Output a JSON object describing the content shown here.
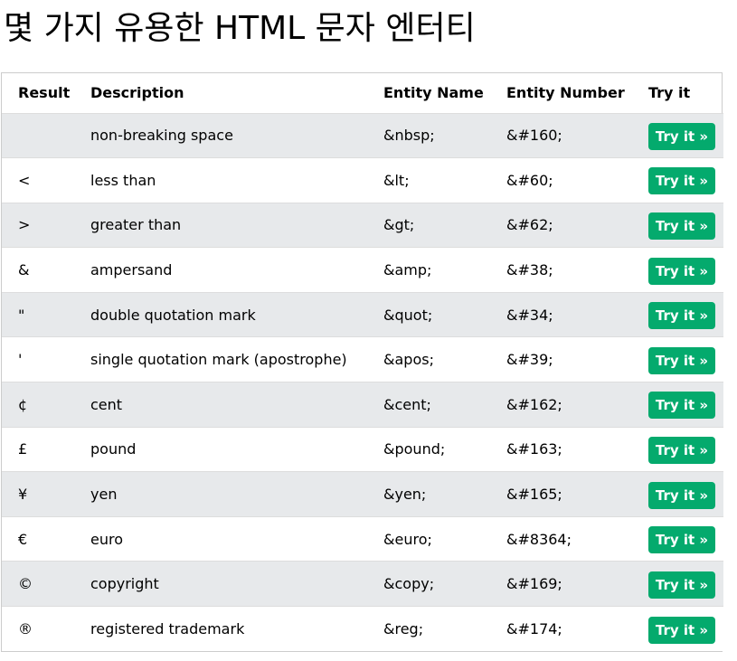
{
  "title": "몇 가지 유용한 HTML 문자 엔터티",
  "table": {
    "headers": {
      "result": "Result",
      "description": "Description",
      "entity_name": "Entity Name",
      "entity_number": "Entity Number",
      "try_it": "Try it"
    },
    "button_label": "Try it »",
    "rows": [
      {
        "result": " ",
        "description": "non-breaking space",
        "entity_name": "&nbsp;",
        "entity_number": "&#160;"
      },
      {
        "result": "<",
        "description": "less than",
        "entity_name": "&lt;",
        "entity_number": "&#60;"
      },
      {
        "result": ">",
        "description": "greater than",
        "entity_name": "&gt;",
        "entity_number": "&#62;"
      },
      {
        "result": "&",
        "description": "ampersand",
        "entity_name": "&amp;",
        "entity_number": "&#38;"
      },
      {
        "result": "\"",
        "description": "double quotation mark",
        "entity_name": "&quot;",
        "entity_number": "&#34;"
      },
      {
        "result": "'",
        "description": "single quotation mark (apostrophe)",
        "entity_name": "&apos;",
        "entity_number": "&#39;"
      },
      {
        "result": "¢",
        "description": "cent",
        "entity_name": "&cent;",
        "entity_number": "&#162;"
      },
      {
        "result": "£",
        "description": "pound",
        "entity_name": "&pound;",
        "entity_number": "&#163;"
      },
      {
        "result": "¥",
        "description": "yen",
        "entity_name": "&yen;",
        "entity_number": "&#165;"
      },
      {
        "result": "€",
        "description": "euro",
        "entity_name": "&euro;",
        "entity_number": "&#8364;"
      },
      {
        "result": "©",
        "description": "copyright",
        "entity_name": "&copy;",
        "entity_number": "&#169;"
      },
      {
        "result": "®",
        "description": "registered trademark",
        "entity_name": "&reg;",
        "entity_number": "&#174;"
      }
    ]
  },
  "colors": {
    "button_background": "#04aa6d",
    "striped_row": "#e7e9eb"
  }
}
